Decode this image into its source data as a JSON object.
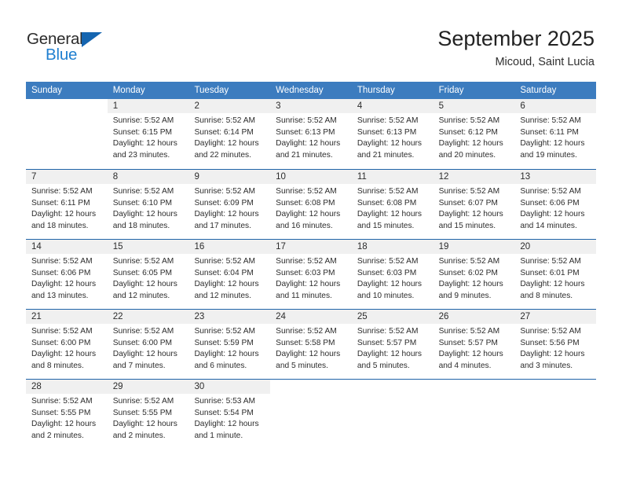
{
  "brand": {
    "name_part1": "General",
    "name_part2": "Blue",
    "triangle_color": "#1565b0",
    "accent_color": "#1f7fd0"
  },
  "header": {
    "title": "September 2025",
    "subtitle": "Micoud, Saint Lucia"
  },
  "theme": {
    "header_bar_color": "#3c7cbf",
    "week_divider_color": "#1f63a8",
    "date_band_color": "#f0f0f0"
  },
  "calendar": {
    "weekdays": [
      "Sunday",
      "Monday",
      "Tuesday",
      "Wednesday",
      "Thursday",
      "Friday",
      "Saturday"
    ],
    "weeks": [
      [
        {
          "day": "",
          "lines": [
            "",
            "",
            "",
            ""
          ]
        },
        {
          "day": "1",
          "lines": [
            "Sunrise: 5:52 AM",
            "Sunset: 6:15 PM",
            "Daylight: 12 hours",
            "and 23 minutes."
          ]
        },
        {
          "day": "2",
          "lines": [
            "Sunrise: 5:52 AM",
            "Sunset: 6:14 PM",
            "Daylight: 12 hours",
            "and 22 minutes."
          ]
        },
        {
          "day": "3",
          "lines": [
            "Sunrise: 5:52 AM",
            "Sunset: 6:13 PM",
            "Daylight: 12 hours",
            "and 21 minutes."
          ]
        },
        {
          "day": "4",
          "lines": [
            "Sunrise: 5:52 AM",
            "Sunset: 6:13 PM",
            "Daylight: 12 hours",
            "and 21 minutes."
          ]
        },
        {
          "day": "5",
          "lines": [
            "Sunrise: 5:52 AM",
            "Sunset: 6:12 PM",
            "Daylight: 12 hours",
            "and 20 minutes."
          ]
        },
        {
          "day": "6",
          "lines": [
            "Sunrise: 5:52 AM",
            "Sunset: 6:11 PM",
            "Daylight: 12 hours",
            "and 19 minutes."
          ]
        }
      ],
      [
        {
          "day": "7",
          "lines": [
            "Sunrise: 5:52 AM",
            "Sunset: 6:11 PM",
            "Daylight: 12 hours",
            "and 18 minutes."
          ]
        },
        {
          "day": "8",
          "lines": [
            "Sunrise: 5:52 AM",
            "Sunset: 6:10 PM",
            "Daylight: 12 hours",
            "and 18 minutes."
          ]
        },
        {
          "day": "9",
          "lines": [
            "Sunrise: 5:52 AM",
            "Sunset: 6:09 PM",
            "Daylight: 12 hours",
            "and 17 minutes."
          ]
        },
        {
          "day": "10",
          "lines": [
            "Sunrise: 5:52 AM",
            "Sunset: 6:08 PM",
            "Daylight: 12 hours",
            "and 16 minutes."
          ]
        },
        {
          "day": "11",
          "lines": [
            "Sunrise: 5:52 AM",
            "Sunset: 6:08 PM",
            "Daylight: 12 hours",
            "and 15 minutes."
          ]
        },
        {
          "day": "12",
          "lines": [
            "Sunrise: 5:52 AM",
            "Sunset: 6:07 PM",
            "Daylight: 12 hours",
            "and 15 minutes."
          ]
        },
        {
          "day": "13",
          "lines": [
            "Sunrise: 5:52 AM",
            "Sunset: 6:06 PM",
            "Daylight: 12 hours",
            "and 14 minutes."
          ]
        }
      ],
      [
        {
          "day": "14",
          "lines": [
            "Sunrise: 5:52 AM",
            "Sunset: 6:06 PM",
            "Daylight: 12 hours",
            "and 13 minutes."
          ]
        },
        {
          "day": "15",
          "lines": [
            "Sunrise: 5:52 AM",
            "Sunset: 6:05 PM",
            "Daylight: 12 hours",
            "and 12 minutes."
          ]
        },
        {
          "day": "16",
          "lines": [
            "Sunrise: 5:52 AM",
            "Sunset: 6:04 PM",
            "Daylight: 12 hours",
            "and 12 minutes."
          ]
        },
        {
          "day": "17",
          "lines": [
            "Sunrise: 5:52 AM",
            "Sunset: 6:03 PM",
            "Daylight: 12 hours",
            "and 11 minutes."
          ]
        },
        {
          "day": "18",
          "lines": [
            "Sunrise: 5:52 AM",
            "Sunset: 6:03 PM",
            "Daylight: 12 hours",
            "and 10 minutes."
          ]
        },
        {
          "day": "19",
          "lines": [
            "Sunrise: 5:52 AM",
            "Sunset: 6:02 PM",
            "Daylight: 12 hours",
            "and 9 minutes."
          ]
        },
        {
          "day": "20",
          "lines": [
            "Sunrise: 5:52 AM",
            "Sunset: 6:01 PM",
            "Daylight: 12 hours",
            "and 8 minutes."
          ]
        }
      ],
      [
        {
          "day": "21",
          "lines": [
            "Sunrise: 5:52 AM",
            "Sunset: 6:00 PM",
            "Daylight: 12 hours",
            "and 8 minutes."
          ]
        },
        {
          "day": "22",
          "lines": [
            "Sunrise: 5:52 AM",
            "Sunset: 6:00 PM",
            "Daylight: 12 hours",
            "and 7 minutes."
          ]
        },
        {
          "day": "23",
          "lines": [
            "Sunrise: 5:52 AM",
            "Sunset: 5:59 PM",
            "Daylight: 12 hours",
            "and 6 minutes."
          ]
        },
        {
          "day": "24",
          "lines": [
            "Sunrise: 5:52 AM",
            "Sunset: 5:58 PM",
            "Daylight: 12 hours",
            "and 5 minutes."
          ]
        },
        {
          "day": "25",
          "lines": [
            "Sunrise: 5:52 AM",
            "Sunset: 5:57 PM",
            "Daylight: 12 hours",
            "and 5 minutes."
          ]
        },
        {
          "day": "26",
          "lines": [
            "Sunrise: 5:52 AM",
            "Sunset: 5:57 PM",
            "Daylight: 12 hours",
            "and 4 minutes."
          ]
        },
        {
          "day": "27",
          "lines": [
            "Sunrise: 5:52 AM",
            "Sunset: 5:56 PM",
            "Daylight: 12 hours",
            "and 3 minutes."
          ]
        }
      ],
      [
        {
          "day": "28",
          "lines": [
            "Sunrise: 5:52 AM",
            "Sunset: 5:55 PM",
            "Daylight: 12 hours",
            "and 2 minutes."
          ]
        },
        {
          "day": "29",
          "lines": [
            "Sunrise: 5:52 AM",
            "Sunset: 5:55 PM",
            "Daylight: 12 hours",
            "and 2 minutes."
          ]
        },
        {
          "day": "30",
          "lines": [
            "Sunrise: 5:53 AM",
            "Sunset: 5:54 PM",
            "Daylight: 12 hours",
            "and 1 minute."
          ]
        },
        {
          "day": "",
          "lines": [
            "",
            "",
            "",
            ""
          ]
        },
        {
          "day": "",
          "lines": [
            "",
            "",
            "",
            ""
          ]
        },
        {
          "day": "",
          "lines": [
            "",
            "",
            "",
            ""
          ]
        },
        {
          "day": "",
          "lines": [
            "",
            "",
            "",
            ""
          ]
        }
      ]
    ]
  }
}
